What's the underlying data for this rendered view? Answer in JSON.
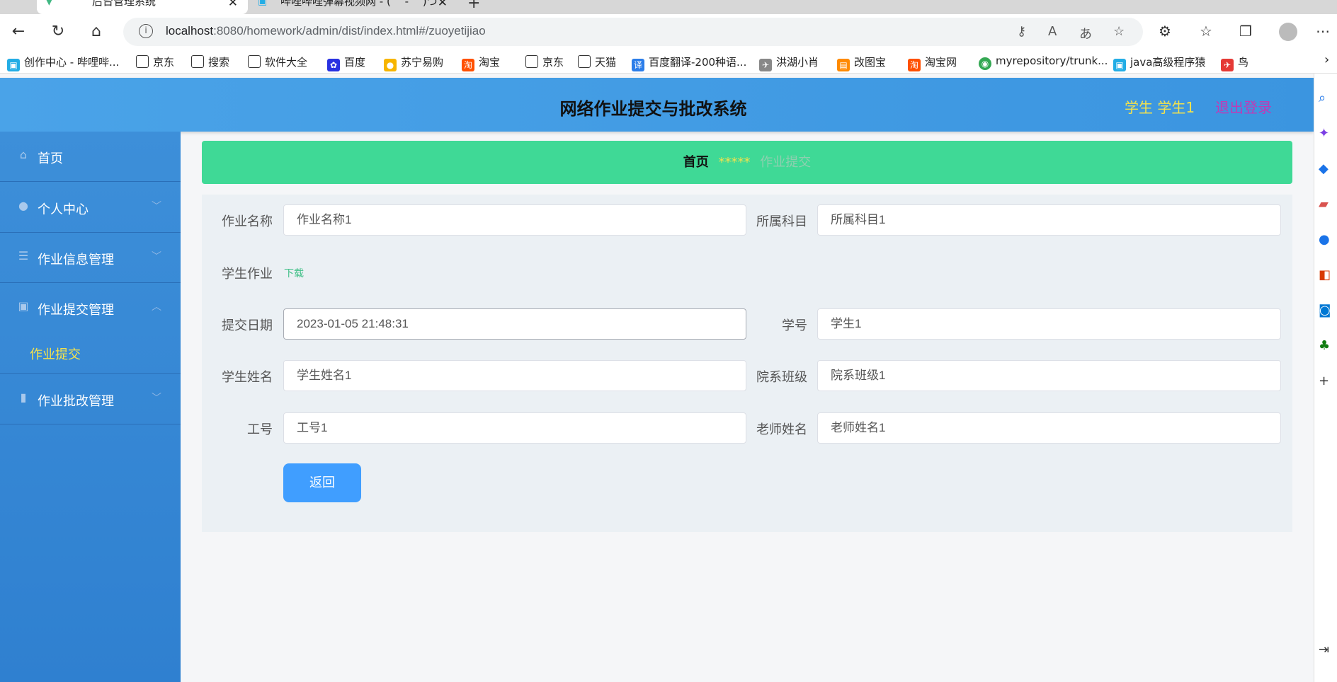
{
  "browser": {
    "tabs": [
      {
        "label": "后台管理系统",
        "active": true
      },
      {
        "label": "哔哩哔哩弹幕视频网 - ( ゜- ゜)つ",
        "active": false
      }
    ],
    "url_host": "localhost",
    "url_path": ":8080/homework/admin/dist/index.html#/zuoyetijiao",
    "bookmarks": [
      {
        "label": "创作中心 - 哔哩哔...",
        "icon": "bilibili-icon",
        "color": "#23ade5"
      },
      {
        "label": "京东",
        "icon": "page-icon",
        "color": ""
      },
      {
        "label": "搜索",
        "icon": "page-icon",
        "color": ""
      },
      {
        "label": "软件大全",
        "icon": "page-icon",
        "color": ""
      },
      {
        "label": "百度",
        "icon": "baidu-icon",
        "color": "#2932e1"
      },
      {
        "label": "苏宁易购",
        "icon": "suning-icon",
        "color": "#f7b500"
      },
      {
        "label": "淘宝",
        "icon": "taobao-icon",
        "color": "#ff5000"
      },
      {
        "label": "京东",
        "icon": "page-icon",
        "color": ""
      },
      {
        "label": "天猫",
        "icon": "page-icon",
        "color": ""
      },
      {
        "label": "百度翻译-200种语...",
        "icon": "translate-icon",
        "color": "#2b7de9"
      },
      {
        "label": "洪湖小肖",
        "icon": "bird-icon",
        "color": "#888"
      },
      {
        "label": "改图宝",
        "icon": "image-icon",
        "color": "#ff8a00"
      },
      {
        "label": "淘宝网",
        "icon": "taobao-icon",
        "color": "#ff5000"
      },
      {
        "label": "myrepository/trunk...",
        "icon": "chrome-icon",
        "color": "#34a853"
      },
      {
        "label": "java高级程序猿",
        "icon": "bilibili-icon",
        "color": "#23ade5"
      },
      {
        "label": "鸟",
        "icon": "bird-icon",
        "color": "#e53935"
      }
    ]
  },
  "header": {
    "title": "网络作业提交与批改系统",
    "user": "学生 学生1",
    "logout": "退出登录"
  },
  "sidebar": {
    "items": [
      {
        "label": "首页",
        "icon": "home-icon"
      },
      {
        "label": "个人中心",
        "icon": "user-icon"
      },
      {
        "label": "作业信息管理",
        "icon": "list-icon"
      },
      {
        "label": "作业提交管理",
        "icon": "clipboard-icon"
      },
      {
        "label": "作业批改管理",
        "icon": "mic-icon"
      }
    ],
    "sub_item": "作业提交"
  },
  "breadcrumb": {
    "home": "首页",
    "sep": "*****",
    "current": "作业提交"
  },
  "form": {
    "homework_name_label": "作业名称",
    "homework_name_value": "作业名称1",
    "subject_label": "所属科目",
    "subject_value": "所属科目1",
    "student_homework_label": "学生作业",
    "download_label": "下载",
    "submit_date_label": "提交日期",
    "submit_date_value": "2023-01-05 21:48:31",
    "student_no_label": "学号",
    "student_no_value": "学生1",
    "student_name_label": "学生姓名",
    "student_name_value": "学生姓名1",
    "class_label": "院系班级",
    "class_value": "院系班级1",
    "job_no_label": "工号",
    "job_no_value": "工号1",
    "teacher_name_label": "老师姓名",
    "teacher_name_value": "老师姓名1",
    "back_button": "返回"
  }
}
